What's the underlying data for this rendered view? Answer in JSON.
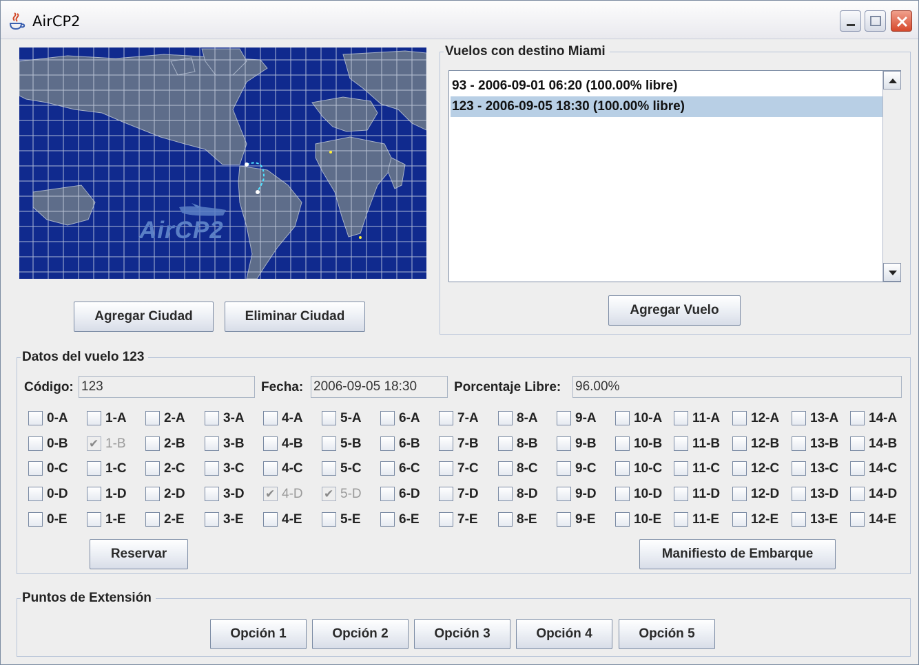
{
  "window": {
    "title": "AirCP2"
  },
  "map": {
    "logo_text": "AirCP2"
  },
  "map_buttons": {
    "add_city": "Agregar Ciudad",
    "remove_city": "Eliminar Ciudad"
  },
  "flights_panel": {
    "title": "Vuelos con destino Miami",
    "items": [
      "93 - 2006-09-01 06:20 (100.00% libre)",
      "123 - 2006-09-05 18:30 (100.00% libre)"
    ],
    "selected_index": 1,
    "add_flight": "Agregar Vuelo"
  },
  "flight_data": {
    "title": "Datos del vuelo 123",
    "code_label": "Código:",
    "code_value": "123",
    "date_label": "Fecha:",
    "date_value": "2006-09-05 18:30",
    "free_label": "Porcentaje Libre:",
    "free_value": "96.00%",
    "reserve": "Reservar",
    "manifest": "Manifiesto de Embarque"
  },
  "seats": {
    "rows": [
      "A",
      "B",
      "C",
      "D",
      "E"
    ],
    "count": 15,
    "reserved": [
      "1-B",
      "4-D",
      "5-D"
    ]
  },
  "extension": {
    "title": "Puntos de Extensión",
    "options": [
      "Opción 1",
      "Opción 2",
      "Opción 3",
      "Opción 4",
      "Opción 5"
    ]
  },
  "colors": {
    "map_bg": "#102a8e",
    "selection": "#b8cfe5",
    "close_button": "#d6482c"
  }
}
